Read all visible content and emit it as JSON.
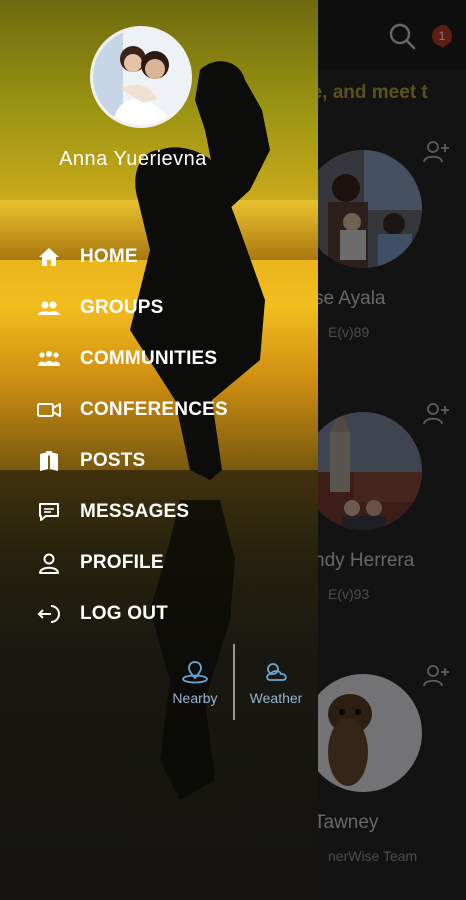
{
  "drawer": {
    "user_name": "Anna Yuerievna",
    "menu": [
      {
        "label": "HOME",
        "icon": "home-icon"
      },
      {
        "label": "GROUPS",
        "icon": "groups-icon"
      },
      {
        "label": "COMMUNITIES",
        "icon": "communities-icon"
      },
      {
        "label": "CONFERENCES",
        "icon": "video-icon"
      },
      {
        "label": "POSTS",
        "icon": "posts-icon"
      },
      {
        "label": "MESSAGES",
        "icon": "messages-icon"
      },
      {
        "label": "PROFILE",
        "icon": "profile-icon"
      },
      {
        "label": "LOG OUT",
        "icon": "logout-icon"
      }
    ],
    "quick_links": [
      {
        "label": "Nearby",
        "icon": "nearby-icon"
      },
      {
        "label": "Weather",
        "icon": "weather-icon"
      }
    ]
  },
  "background": {
    "notification_count": "1",
    "banner_text": "ge, and meet t",
    "cards": [
      {
        "name": "se Ayala",
        "sub": "E(v)89"
      },
      {
        "name": "ndy Herrera",
        "sub": "E(v)93"
      },
      {
        "name": "Tawney",
        "sub": "nerWise Team"
      }
    ]
  },
  "colors": {
    "badge": "#c0392b",
    "banner": "#b9a33a",
    "quick_link": "#8fb6d6"
  }
}
